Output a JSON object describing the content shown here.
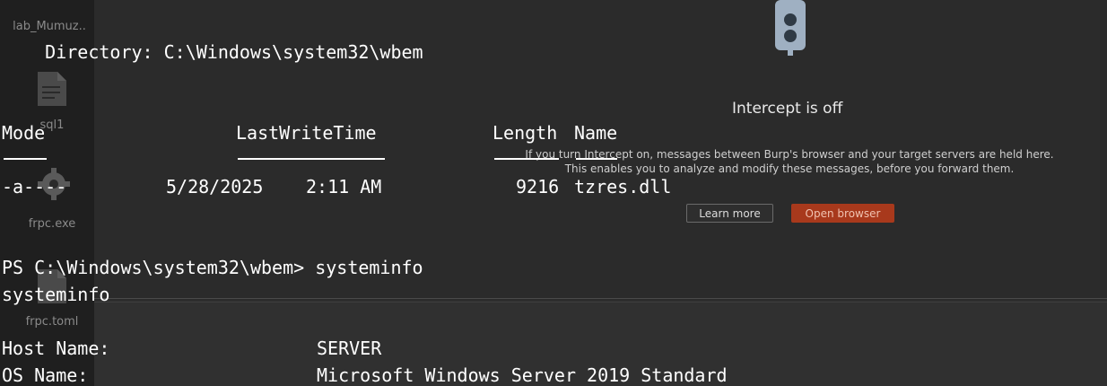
{
  "desktop": {
    "items": [
      {
        "label": "lab_Mumuz..",
        "icon": "folder-icon"
      },
      {
        "label": "sql1",
        "icon": "text-file-icon"
      },
      {
        "label": "frpc.exe",
        "icon": "gear-file-icon"
      },
      {
        "label": "frpc.toml",
        "icon": "text-file-icon"
      }
    ]
  },
  "burp": {
    "title": "Intercept is off",
    "desc_line1": "If you turn Intercept on, messages between Burp's browser and your target servers are held here.",
    "desc_line2": "This enables you to analyze and modify these messages, before you forward them.",
    "learn_more": "Learn more",
    "open_browser": "Open browser",
    "icon": "traffic-light-icon"
  },
  "terminal": {
    "directory_line": "    Directory: C:\\Windows\\system32\\wbem",
    "headers": {
      "mode": "Mode",
      "lastwritetime": "LastWriteTime",
      "length": "Length",
      "name": "Name"
    },
    "rows": [
      {
        "mode": "-a----",
        "date": "5/28/2025",
        "time": "2:11 AM",
        "length": "9216",
        "name": "tzres.dll"
      }
    ],
    "prompt": "PS C:\\Windows\\system32\\wbem> systeminfo",
    "echo": "systeminfo",
    "sysinfo": [
      {
        "key": "Host Name:",
        "value": "SERVER"
      },
      {
        "key": "OS Name:",
        "value": "Microsoft Windows Server 2019 Standard"
      }
    ]
  }
}
